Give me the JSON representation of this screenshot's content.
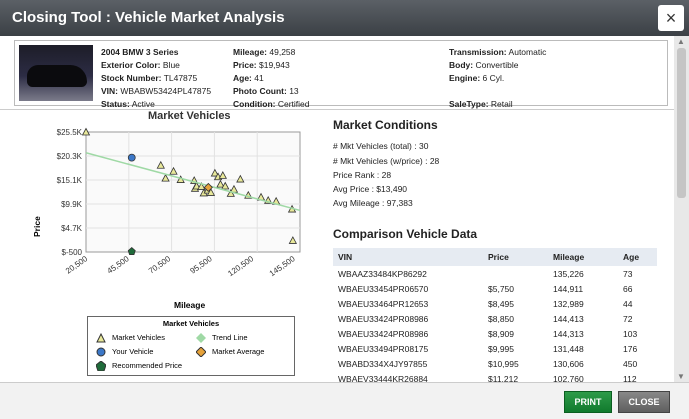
{
  "window": {
    "title": "Closing Tool : Vehicle Market Analysis",
    "close_glyph": "×"
  },
  "vehicle": {
    "col1": [
      {
        "label": "",
        "value": "2004 BMW 3 Series",
        "bold": true
      },
      {
        "label": "Exterior Color:",
        "value": "Blue"
      },
      {
        "label": "Stock Number:",
        "value": "TL47875"
      },
      {
        "label": "VIN:",
        "value": "WBABW53424PL47875"
      },
      {
        "label": "Status:",
        "value": "Active"
      }
    ],
    "col2": [
      {
        "label": "Mileage:",
        "value": "49,258"
      },
      {
        "label": "Price:",
        "value": "$19,943"
      },
      {
        "label": "Age:",
        "value": "41"
      },
      {
        "label": "Photo Count:",
        "value": "13"
      },
      {
        "label": "Condition:",
        "value": "Certified"
      }
    ],
    "col3": [
      {
        "label": "Transmission:",
        "value": "Automatic"
      },
      {
        "label": "Body:",
        "value": "Convertible"
      },
      {
        "label": "Engine:",
        "value": "6 Cyl."
      },
      {
        "label": "",
        "value": ""
      },
      {
        "label": "SaleType:",
        "value": "Retail"
      }
    ]
  },
  "chart_data": {
    "type": "scatter",
    "title": "Market Vehicles",
    "xlabel": "Mileage",
    "ylabel": "Price",
    "xlim": [
      20500,
      155000
    ],
    "ylim": [
      -500,
      25500
    ],
    "x_ticks": [
      "20,500",
      "45,500",
      "70,500",
      "95,500",
      "120,500",
      "145,500"
    ],
    "y_ticks": [
      "$25.5K",
      "$20.3K",
      "$15.1K",
      "$9.9K",
      "$4.7K",
      "$-500"
    ],
    "grid": true,
    "legend_position": "bottom",
    "series": [
      {
        "name": "Market Vehicles",
        "marker": "triangle",
        "color": "#e8e89a",
        "points": [
          [
            20500,
            25500
          ],
          [
            67500,
            18300
          ],
          [
            75500,
            17000
          ],
          [
            80000,
            15200
          ],
          [
            70500,
            15500
          ],
          [
            88500,
            15000
          ],
          [
            89000,
            13300
          ],
          [
            90000,
            13800
          ],
          [
            93000,
            13700
          ],
          [
            94500,
            12300
          ],
          [
            97000,
            12900
          ],
          [
            99000,
            12400
          ],
          [
            101500,
            16600
          ],
          [
            103500,
            15800
          ],
          [
            105000,
            14200
          ],
          [
            106500,
            16100
          ],
          [
            108000,
            13800
          ],
          [
            111500,
            12200
          ],
          [
            113500,
            13100
          ],
          [
            117500,
            15300
          ],
          [
            122500,
            11800
          ],
          [
            130500,
            11400
          ],
          [
            135000,
            10700
          ],
          [
            140000,
            10500
          ],
          [
            150000,
            8800
          ],
          [
            150500,
            2000
          ]
        ]
      },
      {
        "name": "Trend Line",
        "marker": "line",
        "color": "#9fd9a5",
        "points": [
          [
            20500,
            21000
          ],
          [
            155000,
            8500
          ]
        ]
      },
      {
        "name": "Your Vehicle",
        "marker": "circle",
        "color": "#3c78c8",
        "points": [
          [
            49258,
            19943
          ]
        ]
      },
      {
        "name": "Market Average",
        "marker": "diamond",
        "color": "#e6a23a",
        "points": [
          [
            97383,
            13490
          ]
        ]
      },
      {
        "name": "Recommended Price",
        "marker": "pentagon",
        "color": "#1f6b3a",
        "points": [
          [
            49258,
            -300
          ]
        ]
      }
    ]
  },
  "legend": {
    "title": "Market Vehicles",
    "items": [
      {
        "label": "Market Vehicles"
      },
      {
        "label": "Trend Line"
      },
      {
        "label": "Your Vehicle"
      },
      {
        "label": "Market Average"
      },
      {
        "label": "Recommended Price"
      }
    ]
  },
  "market_conditions": {
    "title": "Market Conditions",
    "lines": [
      "# Mkt Vehicles (total) : 30",
      "# Mkt Vehicles (w/price) : 28",
      "Price Rank : 28",
      "Avg Price : $13,490",
      "Avg Mileage : 97,383"
    ]
  },
  "comparison": {
    "title": "Comparison Vehicle Data",
    "headers": [
      "VIN",
      "Price",
      "Mileage",
      "Age"
    ],
    "rows": [
      [
        "WBAAZ33484KP86292",
        "",
        "135,226",
        "73"
      ],
      [
        "WBAEU33454PR06570",
        "$5,750",
        "144,911",
        "66"
      ],
      [
        "WBAEU33464PR12653",
        "$8,495",
        "132,989",
        "44"
      ],
      [
        "WBAEU33424PR08986",
        "$8,850",
        "144,413",
        "72"
      ],
      [
        "WBAEU33424PR08986",
        "$8,909",
        "144,313",
        "103"
      ],
      [
        "WBAEU33494PR08175",
        "$9,995",
        "131,448",
        "176"
      ],
      [
        "WBABD334X4JY97855",
        "$10,995",
        "130,606",
        "450"
      ],
      [
        "WBAEV33444KR26884",
        "$11,212",
        "102,760",
        "112"
      ]
    ]
  },
  "footer": {
    "print_label": "PRINT",
    "close_label": "CLOSE"
  }
}
